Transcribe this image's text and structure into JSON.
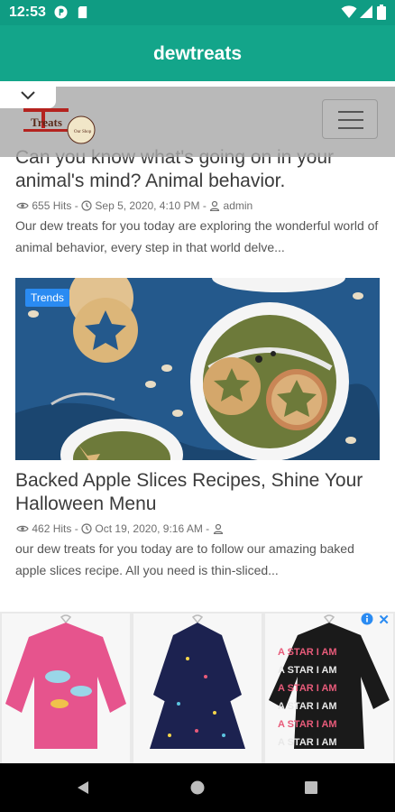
{
  "status_bar": {
    "time": "12:53",
    "left_icons": [
      "circle-p-icon",
      "sd-card-icon"
    ],
    "right_icons": [
      "wifi-icon",
      "cell-signal-icon",
      "battery-icon"
    ],
    "color": "#0f9c83"
  },
  "app_bar": {
    "title": "dewtreats",
    "color": "#13a58a"
  },
  "site_header": {
    "logo_text": "Treats",
    "logo_small_text": "Our Shop",
    "menu_icon": "hamburger-menu-icon",
    "collapse_icon": "chevron-down-icon"
  },
  "articles": [
    {
      "title": "Can you know what's going on in your animal's mind? Animal behavior.",
      "hits": "655 Hits",
      "date": "Sep 5, 2020, 4:10 PM",
      "author": "admin",
      "excerpt": "Our dew treats for you today are exploring the wonderful world of animal behavior, every step in that world delve..."
    },
    {
      "badge": "Trends",
      "title": "Backed Apple Slices Recipes, Shine Your Halloween Menu",
      "hits": "462 Hits",
      "date": "Oct 19, 2020, 9:16 AM",
      "author": "",
      "excerpt": "our dew treats for you today are to follow our amazing baked apple slices recipe. All you need is thin-sliced..."
    }
  ],
  "meta_separator": "-",
  "ad": {
    "close_label": "✕",
    "info_icon": "info-icon",
    "products": [
      "pink-fish-shirt",
      "navy-confetti-dress",
      "star-print-sweater"
    ],
    "star_text": "A STAR I AM"
  },
  "nav_bar": {
    "icons": [
      "back-triangle-icon",
      "home-circle-icon",
      "recents-square-icon"
    ]
  },
  "colors": {
    "accent": "#13a58a",
    "badge": "#2a8bf2",
    "text": "#3b3b3b",
    "meta": "#6f6f6f"
  }
}
